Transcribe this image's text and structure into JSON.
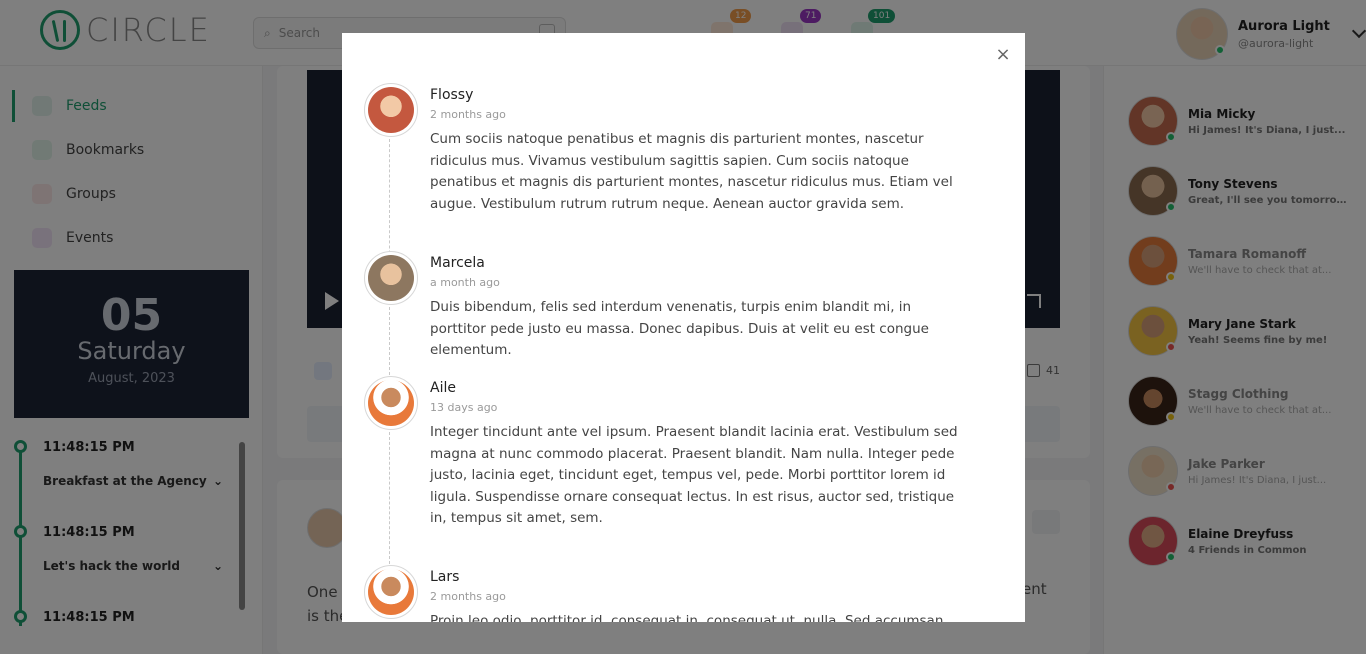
{
  "header": {
    "logo_text": "CIRCLE",
    "search_placeholder": "Search",
    "badges": {
      "friends": "12",
      "messages": "71",
      "notifications": "101"
    },
    "user_name": "Aurora Light",
    "user_handle": "@aurora-light"
  },
  "sidebar": {
    "items": [
      {
        "label": "Feeds",
        "icon": "feeds-icon",
        "color": "#1f9e6e"
      },
      {
        "label": "Bookmarks",
        "icon": "bookmark-icon",
        "color": "#29b36b"
      },
      {
        "label": "Groups",
        "icon": "groups-icon",
        "color": "#ef6b6b"
      },
      {
        "label": "Events",
        "icon": "calendar-icon",
        "color": "#9b37c4"
      }
    ],
    "date": {
      "day": "05",
      "weekday": "Saturday",
      "month_year": "August, 2023"
    },
    "timeline": [
      {
        "time": "11:48:15 PM",
        "title": "Breakfast at the Agency"
      },
      {
        "time": "11:48:15 PM",
        "title": "Let's hack the world"
      },
      {
        "time": "11:48:15 PM",
        "title": ""
      }
    ]
  },
  "feed": {
    "share_count": "41",
    "post_text_left_1": "One c",
    "post_text_left_2": "is the",
    "post_text_right": "ent"
  },
  "contacts": [
    {
      "name": "Mia Micky",
      "message": "Hi James! It's Diana, I just...",
      "status": "#25c06d",
      "muted": false,
      "tone": "#c46a4e"
    },
    {
      "name": "Tony Stevens",
      "message": "Great, I'll see you tomorrow!.",
      "status": "#25c06d",
      "muted": false,
      "tone": "#8a6a4e"
    },
    {
      "name": "Tamara Romanoff",
      "message": "We'll have to check that at...",
      "status": "#f0c419",
      "muted": true,
      "tone": "#e57a3a"
    },
    {
      "name": "Mary Jane Stark",
      "message": "Yeah! Seems fine by me!",
      "status": "#ef5350",
      "muted": false,
      "tone": "#f4c542"
    },
    {
      "name": "Stagg Clothing",
      "message": "We'll have to check that at...",
      "status": "#f0c419",
      "muted": true,
      "tone": "#5a3a2a"
    },
    {
      "name": "Jake Parker",
      "message": "Hi James! It's Diana, I just...",
      "status": "#ef5350",
      "muted": true,
      "tone": "#d9a86b"
    },
    {
      "name": "Elaine Dreyfuss",
      "message": "4 Friends in Common",
      "status": "#25c06d",
      "muted": false,
      "tone": "#d84a5a"
    }
  ],
  "modal": {
    "close_label": "×",
    "comments": [
      {
        "name": "Flossy",
        "time": "2 months ago",
        "text": "Cum sociis natoque penatibus et magnis dis parturient montes, nascetur ridiculus mus. Vivamus vestibulum sagittis sapien. Cum sociis natoque penatibus et magnis dis parturient montes, nascetur ridiculus mus. Etiam vel augue. Vestibulum rutrum rutrum neque. Aenean auctor gravida sem.",
        "tone": "#c4583f"
      },
      {
        "name": "Marcela",
        "time": "a month ago",
        "text": "Duis bibendum, felis sed interdum venenatis, turpis enim blandit mi, in porttitor pede justo eu massa. Donec dapibus. Duis at velit eu est congue elementum.",
        "tone": "#8d7760"
      },
      {
        "name": "Aile",
        "time": "13 days ago",
        "text": "Integer tincidunt ante vel ipsum. Praesent blandit lacinia erat. Vestibulum sed magna at nunc commodo placerat. Praesent blandit. Nam nulla. Integer pede justo, lacinia eget, tincidunt eget, tempus vel, pede. Morbi porttitor lorem id ligula. Suspendisse ornare consequat lectus. In est risus, auctor sed, tristique in, tempus sit amet, sem.",
        "tone": "#e8793a"
      },
      {
        "name": "Lars",
        "time": "2 months ago",
        "text": "Proin leo odio, porttitor id, consequat in, consequat ut, nulla. Sed accumsan felis. Ut at dolor quis odio consequat varius.",
        "tone": "#e8793a"
      }
    ]
  }
}
